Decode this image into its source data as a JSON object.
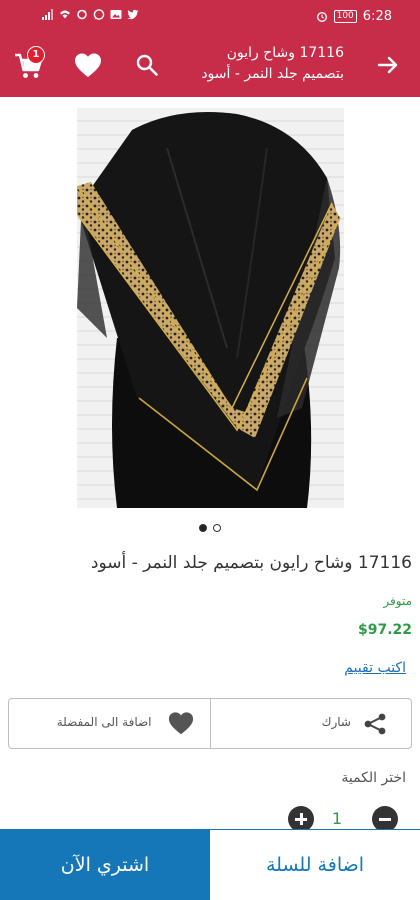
{
  "status_bar": {
    "time": "6:28",
    "battery": "100",
    "icons": [
      "signal-icon",
      "wifi-icon",
      "sync-icon",
      "whatsapp-icon",
      "photo-icon",
      "twitter-icon",
      "alarm-icon",
      "battery-icon"
    ]
  },
  "header": {
    "title_line1": "17116 وشاح رايون",
    "title_line2": "بتصميم جلد النمر - أسود",
    "cart_count": "1",
    "icons": [
      "cart-icon",
      "heart-icon",
      "search-icon",
      "back-arrow-icon"
    ]
  },
  "colors": {
    "brand": "#c72c49",
    "accent_blue": "#1677b8",
    "success_green": "#2e9b46"
  },
  "gallery": {
    "image_count": 2,
    "active_index": 0
  },
  "product": {
    "title": "17116 وشاح رايون بتصميم جلد النمر - أسود",
    "availability": "متوفر",
    "price": "$97.22",
    "review_link": "اكتب تقييم"
  },
  "actions": {
    "favorite_label": "اضافة الى المفضلة",
    "share_label": "شارك"
  },
  "quantity": {
    "label": "اختر الكمية",
    "value": "1"
  },
  "bottom": {
    "buy_now": "اشتري الآن",
    "add_to_cart": "اضافة للسلة"
  }
}
